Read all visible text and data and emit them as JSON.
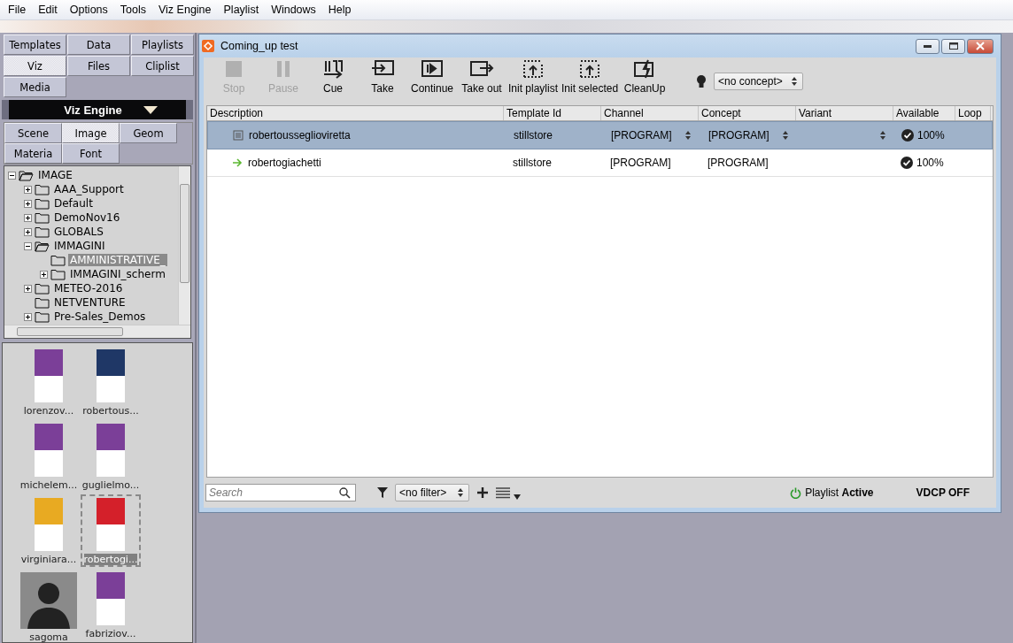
{
  "menu": [
    "File",
    "Edit",
    "Options",
    "Tools",
    "Viz Engine",
    "Playlist",
    "Windows",
    "Help"
  ],
  "main_tabs": [
    {
      "label": "Templates",
      "selected": false
    },
    {
      "label": "Data",
      "selected": false
    },
    {
      "label": "Playlists",
      "selected": false
    },
    {
      "label": "Viz",
      "selected": true
    },
    {
      "label": "Files",
      "selected": false
    },
    {
      "label": "Cliplist",
      "selected": false
    },
    {
      "label": "Media",
      "selected": false
    }
  ],
  "engine_selector": {
    "value": "Viz Engine"
  },
  "sub_tabs": [
    {
      "label": "Scene",
      "selected": false
    },
    {
      "label": "Image",
      "selected": true
    },
    {
      "label": "Geom",
      "selected": false
    },
    {
      "label": "Materia",
      "selected": false
    },
    {
      "label": "Font",
      "selected": false
    }
  ],
  "tree": [
    {
      "label": "IMAGE",
      "expandable": true,
      "expanded": true,
      "selected": false,
      "children": [
        {
          "label": "AAA_Support",
          "expandable": true,
          "expanded": false,
          "selected": false
        },
        {
          "label": "Default",
          "expandable": true,
          "expanded": false,
          "selected": false
        },
        {
          "label": "DemoNov16",
          "expandable": true,
          "expanded": false,
          "selected": false
        },
        {
          "label": "GLOBALS",
          "expandable": true,
          "expanded": false,
          "selected": false
        },
        {
          "label": "IMMAGINI",
          "expandable": true,
          "expanded": true,
          "selected": false,
          "children": [
            {
              "label": "AMMINISTRATIVE_",
              "expandable": false,
              "expanded": false,
              "selected": true
            },
            {
              "label": "IMMAGINI_scherm",
              "expandable": true,
              "expanded": false,
              "selected": false
            }
          ]
        },
        {
          "label": "METEO-2016",
          "expandable": true,
          "expanded": false,
          "selected": false
        },
        {
          "label": "NETVENTURE",
          "expandable": false,
          "expanded": false,
          "selected": false
        },
        {
          "label": "Pre-Sales_Demos",
          "expandable": true,
          "expanded": false,
          "selected": false
        }
      ]
    }
  ],
  "thumbnails": [
    {
      "label": "lorenzov...",
      "kind": "photo",
      "color": "#7b3f98",
      "selected": false
    },
    {
      "label": "robertous...",
      "kind": "photo",
      "color": "#1f3766",
      "selected": false
    },
    {
      "label": "michelem...",
      "kind": "photo",
      "color": "#7b3f98",
      "selected": false
    },
    {
      "label": "guglielmo...",
      "kind": "photo",
      "color": "#7b3f98",
      "selected": false
    },
    {
      "label": "virginiara...",
      "kind": "photo",
      "color": "#e8aa22",
      "selected": false
    },
    {
      "label": "robertogi...",
      "kind": "photo",
      "color": "#d4202a",
      "selected": true
    },
    {
      "label": "sagoma",
      "kind": "silhouette",
      "color": "#8a8a8a",
      "selected": false
    },
    {
      "label": "fabriziov...",
      "kind": "photo",
      "color": "#7b3f98",
      "selected": false
    }
  ],
  "window": {
    "title": "Coming_up test"
  },
  "toolbar": [
    {
      "label": "Stop",
      "kind": "stop",
      "disabled": true
    },
    {
      "label": "Pause",
      "kind": "pause",
      "disabled": true
    },
    {
      "label": "Cue",
      "kind": "cue",
      "disabled": false
    },
    {
      "label": "Take",
      "kind": "take",
      "disabled": false
    },
    {
      "label": "Continue",
      "kind": "continue",
      "disabled": false
    },
    {
      "label": "Take out",
      "kind": "takeout",
      "disabled": false
    },
    {
      "label": "Init playlist",
      "kind": "init",
      "disabled": false
    },
    {
      "label": "Init selected",
      "kind": "initsel",
      "disabled": false
    },
    {
      "label": "CleanUp",
      "kind": "cleanup",
      "disabled": false
    }
  ],
  "concept_select": {
    "value": "<no concept>"
  },
  "table": {
    "columns": [
      "Description",
      "Template Id",
      "Channel",
      "Concept",
      "Variant",
      "Available",
      "Loop"
    ],
    "rows": [
      {
        "kind": "image",
        "description": "robertousseglioviretta",
        "template_id": "stillstore",
        "channel": "[PROGRAM]",
        "concept": "[PROGRAM]",
        "available": "100%",
        "selected": true
      },
      {
        "kind": "next",
        "description": "robertogiachetti",
        "template_id": "stillstore",
        "channel": "[PROGRAM]",
        "concept": "[PROGRAM]",
        "available": "100%",
        "selected": false
      }
    ]
  },
  "footer": {
    "search": {
      "placeholder": "Search"
    },
    "filter": "<no filter>",
    "playlist_status": "Playlist **Active**",
    "vdcp": "VDCP OFF"
  }
}
